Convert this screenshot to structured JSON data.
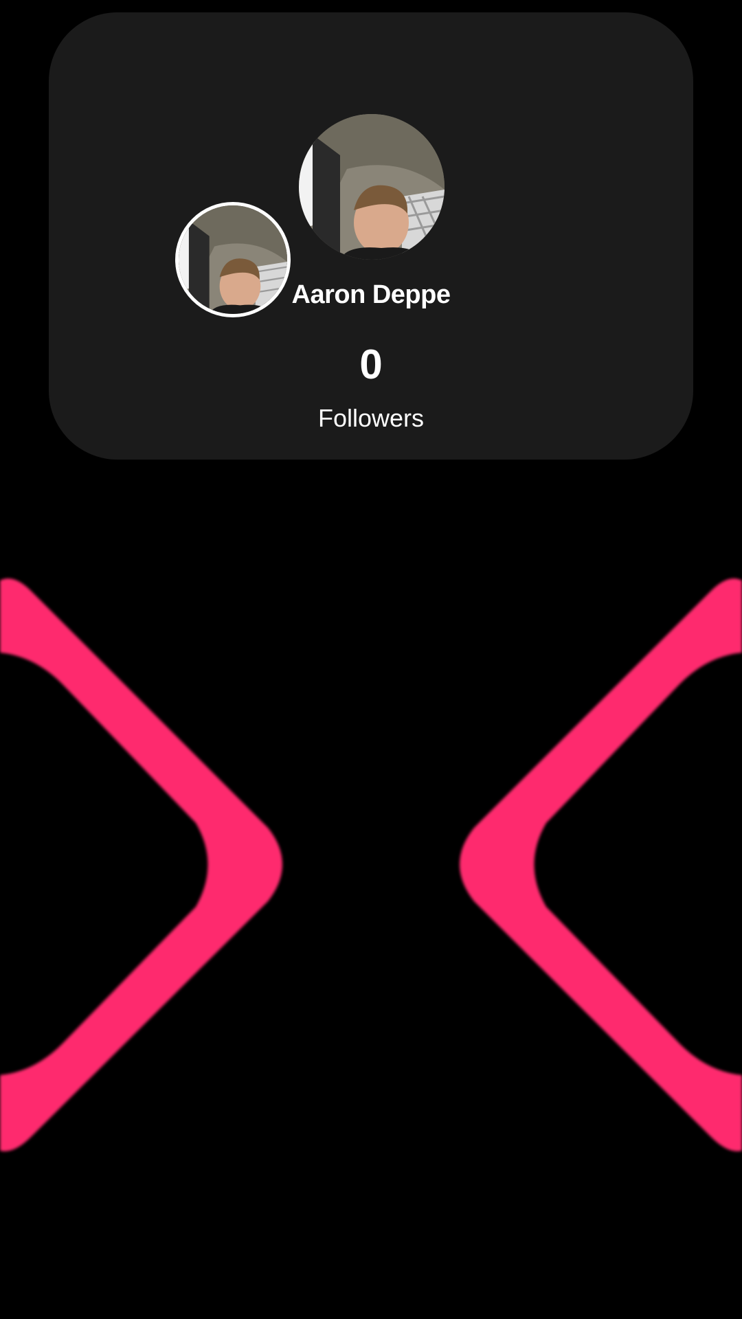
{
  "profile": {
    "display_name": "Aaron Deppe",
    "follower_count": "0",
    "follower_label": "Followers",
    "avatar_primary": "profile-photo",
    "avatar_secondary": "profile-photo"
  },
  "colors": {
    "background": "#000000",
    "card": "#1b1b1b",
    "text": "#ffffff",
    "accent": "#fe2c6e"
  }
}
